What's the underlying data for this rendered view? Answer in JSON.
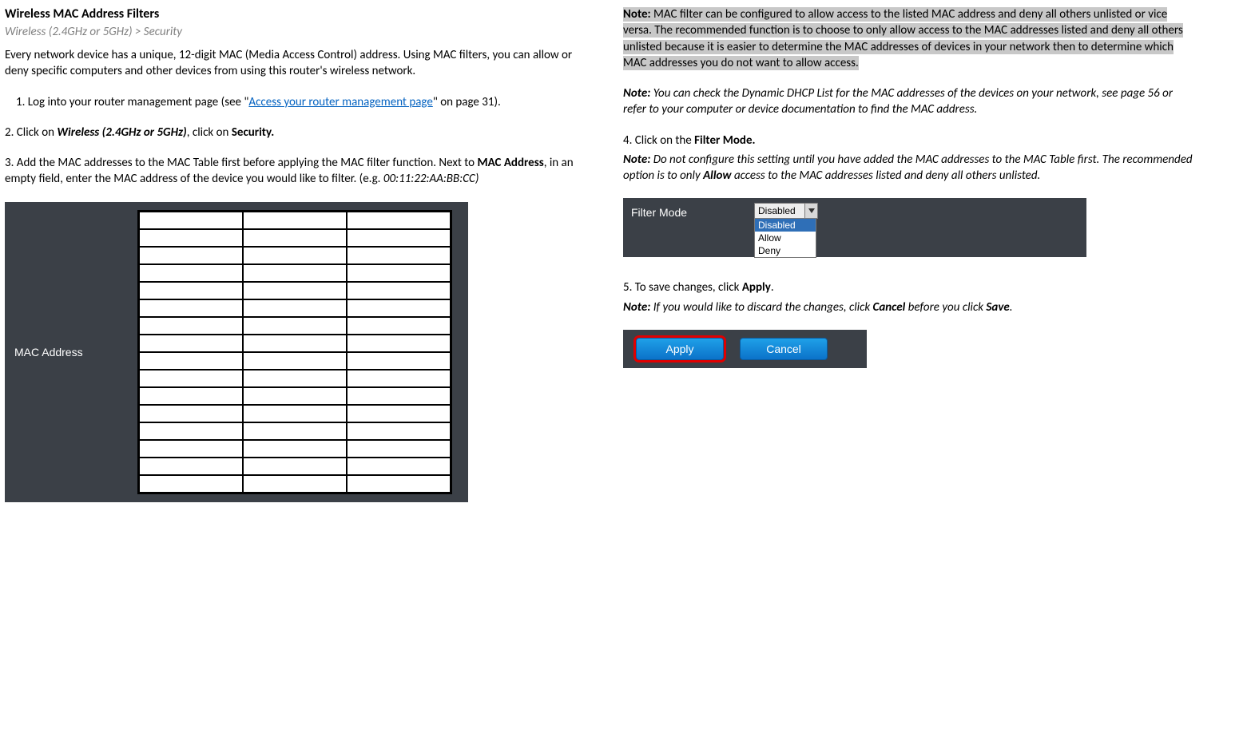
{
  "left": {
    "title": "Wireless MAC Address Filters",
    "breadcrumb": "Wireless (2.4GHz or 5GHz) > Security",
    "intro": "Every network device has a unique, 12-digit MAC (Media Access Control) address. Using MAC filters, you can allow or deny specific computers and other devices from using this router's wireless network.",
    "step1a": "1. Log into your router management page (see \"",
    "link": "Access your router management page",
    "step1b": "\" on page 31).",
    "step2a": "2. Click on ",
    "step2b": "Wireless (2.4GHz or 5GHz)",
    "step2c": ", click on ",
    "step2d": "Security.",
    "step3a": "3. Add the MAC addresses to the MAC Table first before applying the MAC filter function. Next to ",
    "step3b": "MAC Address",
    "step3c": ", in an empty field, enter the MAC address of the device you would like to filter. (e.g. ",
    "step3d": "00:11:22:AA:BB:CC)",
    "mac_label": "MAC Address"
  },
  "right": {
    "note1a": "Note:",
    "note1b": " MAC filter can be configured to allow access to the listed MAC address and deny all others unlisted or vice versa. The recommended function is to choose to only allow access to the MAC addresses listed and deny all others unlisted because it is easier to determine the MAC addresses of devices in your network then to determine which MAC addresses you do not want to allow access.",
    "note2a": "Note:",
    "note2b": " You can check the Dynamic DHCP List for the MAC addresses of the devices on your network, see page 56 or refer to your computer or device documentation to find the MAC address.",
    "step4a": "4. Click on the ",
    "step4b": "Filter Mode.",
    "note3a": "Note:",
    "note3b": " Do not configure this setting until you have added the MAC addresses to the MAC Table first. The recommended option is to only ",
    "note3c": "Allow",
    "note3d": " access to the MAC addresses listed and deny all others unlisted.",
    "filter_label": "Filter Mode",
    "filter_selected": "Disabled",
    "filter_options": {
      "a": "Disabled",
      "b": "Allow",
      "c": "Deny"
    },
    "step5a": "5. To save changes, click ",
    "step5b": "Apply",
    "step5c": ".",
    "note4a": "Note:",
    "note4b": " If you would like to discard the changes, click ",
    "note4c": "Cancel",
    "note4d": " before you click ",
    "note4e": "Save",
    "note4f": ".",
    "apply_btn": "Apply",
    "cancel_btn": "Cancel"
  }
}
